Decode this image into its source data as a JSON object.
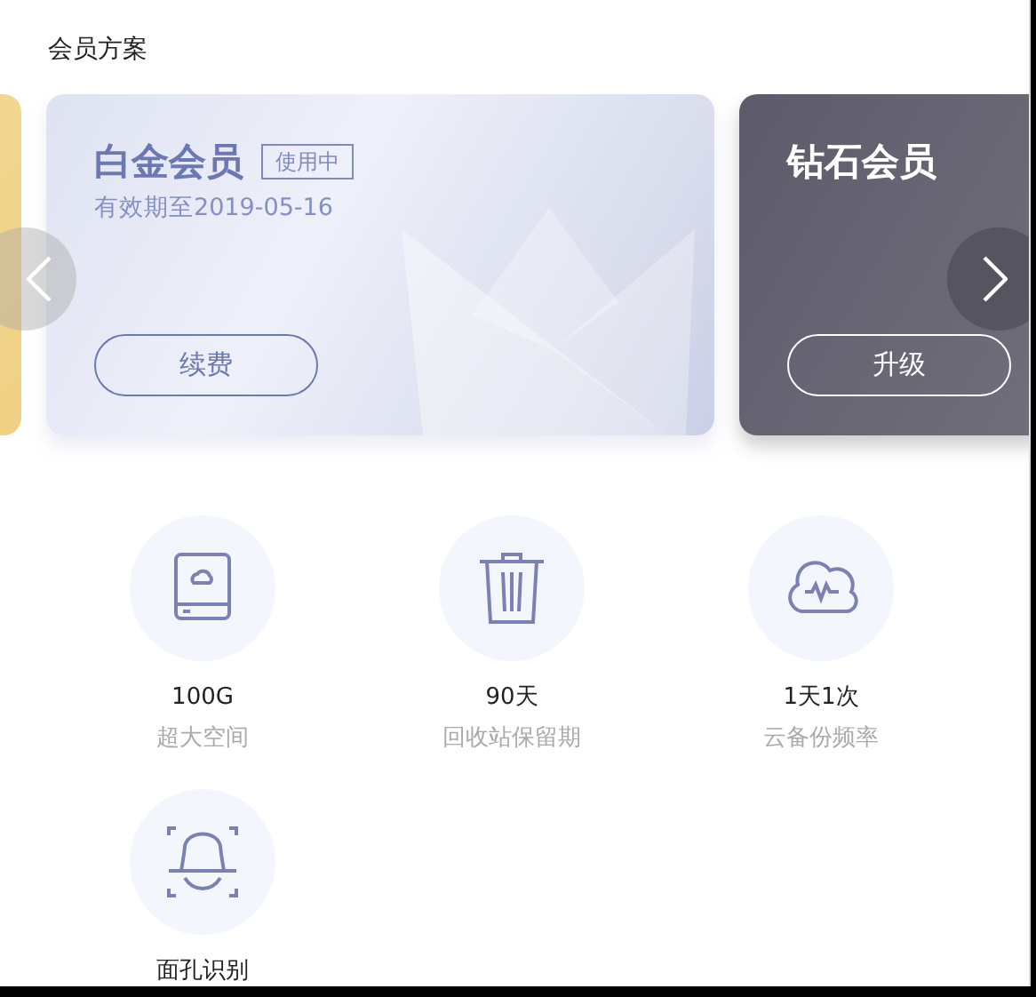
{
  "section_title": "会员方案",
  "plans": [
    {
      "kind": "gold"
    },
    {
      "kind": "platinum",
      "title": "白金会员",
      "badge": "使用中",
      "validity": "有效期至2019-05-16",
      "action": "续费"
    },
    {
      "kind": "diamond",
      "title": "钻石会员",
      "action": "升级"
    }
  ],
  "features": [
    {
      "value": "100G",
      "label": "超大空间"
    },
    {
      "value": "90天",
      "label": "回收站保留期"
    },
    {
      "value": "1天1次",
      "label": "云备份频率"
    },
    {
      "value": "面孔识别"
    }
  ]
}
